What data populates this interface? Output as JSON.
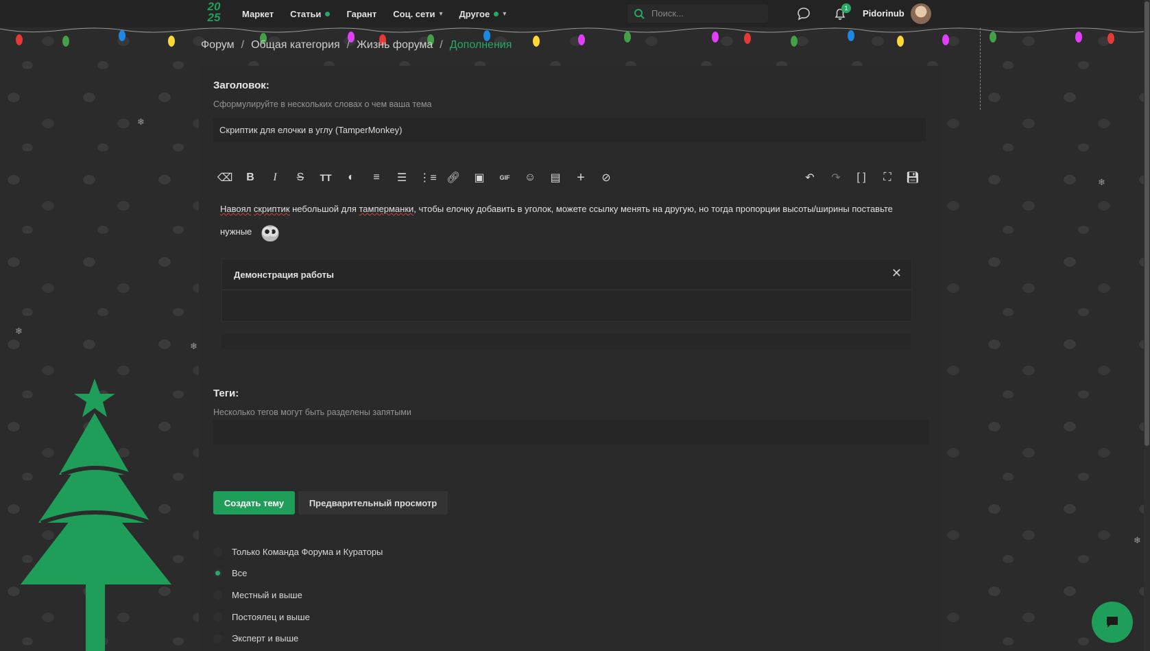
{
  "brand": {
    "logo_top": "20",
    "logo_bottom": "25"
  },
  "nav": {
    "items": [
      {
        "label": "Маркет"
      },
      {
        "label": "Статьи"
      },
      {
        "label": "Гарант"
      },
      {
        "label": "Соц. сети"
      },
      {
        "label": "Другое"
      }
    ]
  },
  "search": {
    "placeholder": "Поиск..."
  },
  "notifications": {
    "count": "1"
  },
  "user": {
    "name": "Pidorinub"
  },
  "breadcrumb": {
    "items": [
      "Форум",
      "Общая категория",
      "Жизнь форума"
    ],
    "current": "Дополнения",
    "separator": "/"
  },
  "form": {
    "title_label": "Заголовок:",
    "title_hint": "Сформулируйте в нескольких словах о чем ваша тема",
    "title_value": "Скриптик для елочки в углу (TamperMonkey)",
    "editor": {
      "text_word_1": "Навоял",
      "text_word_2": "скриптик",
      "text_part_3": "небольшой для",
      "text_word_4": "тамперманки",
      "text_part_5": ", чтобы елочку добавить в уголок, можете ссылку менять на другую, но тогда пропорции высоты/ширины поставьте нужные",
      "spoiler_title": "Демонстрация работы"
    },
    "tags_label": "Теги:",
    "tags_hint": "Несколько тегов могут быть разделены запятыми",
    "submit_label": "Создать тему",
    "preview_label": "Предварительный просмотр",
    "visibility_options": [
      {
        "label": "Только Команда Форума и Кураторы",
        "checked": false
      },
      {
        "label": "Все",
        "checked": true
      },
      {
        "label": "Местный и выше",
        "checked": false
      },
      {
        "label": "Постоялец и выше",
        "checked": false
      },
      {
        "label": "Эксперт и выше",
        "checked": false
      }
    ]
  },
  "colors": {
    "accent": "#1f9e5a",
    "background": "#2b2b2b",
    "panel": "#2a2a2a",
    "topbar": "#232323"
  }
}
